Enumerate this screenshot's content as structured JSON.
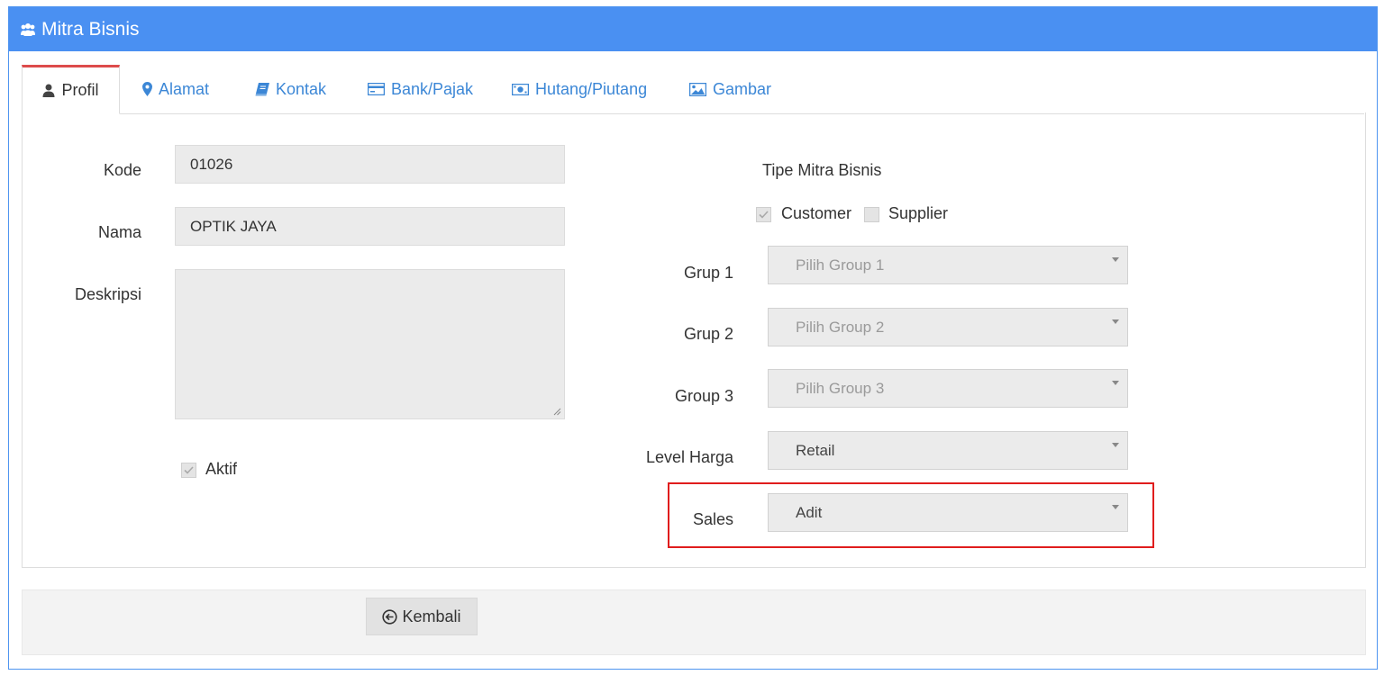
{
  "header": {
    "title": "Mitra Bisnis",
    "icon": "users-icon"
  },
  "tabs": [
    {
      "label": "Profil",
      "icon": "user-icon",
      "active": true
    },
    {
      "label": "Alamat",
      "icon": "map-marker-icon"
    },
    {
      "label": "Kontak",
      "icon": "book-icon"
    },
    {
      "label": "Bank/Pajak",
      "icon": "credit-card-icon"
    },
    {
      "label": "Hutang/Piutang",
      "icon": "money-icon"
    },
    {
      "label": "Gambar",
      "icon": "image-icon"
    }
  ],
  "form": {
    "kode": {
      "label": "Kode",
      "value": "01026"
    },
    "nama": {
      "label": "Nama",
      "value": "OPTIK JAYA"
    },
    "deskripsi": {
      "label": "Deskripsi",
      "value": ""
    },
    "aktif": {
      "label": "Aktif",
      "checked": true
    }
  },
  "tipe": {
    "title": "Tipe Mitra Bisnis",
    "customer": {
      "label": "Customer",
      "checked": true
    },
    "supplier": {
      "label": "Supplier",
      "checked": false
    }
  },
  "selects": {
    "grup1": {
      "label": "Grup 1",
      "value": "Pilih Group 1",
      "placeholder": true
    },
    "grup2": {
      "label": "Grup 2",
      "value": "Pilih Group 2",
      "placeholder": true
    },
    "group3": {
      "label": "Group 3",
      "value": "Pilih Group 3",
      "placeholder": true
    },
    "level_harga": {
      "label": "Level Harga",
      "value": "Retail"
    },
    "sales": {
      "label": "Sales",
      "value": "Adit"
    }
  },
  "footer": {
    "back_label": "Kembali",
    "back_icon": "arrow-circle-left-icon"
  },
  "colors": {
    "header": "#4a90f2",
    "highlight": "#e01d1d",
    "active_tab_top": "#dd4b4b",
    "link": "#3c87d6"
  }
}
